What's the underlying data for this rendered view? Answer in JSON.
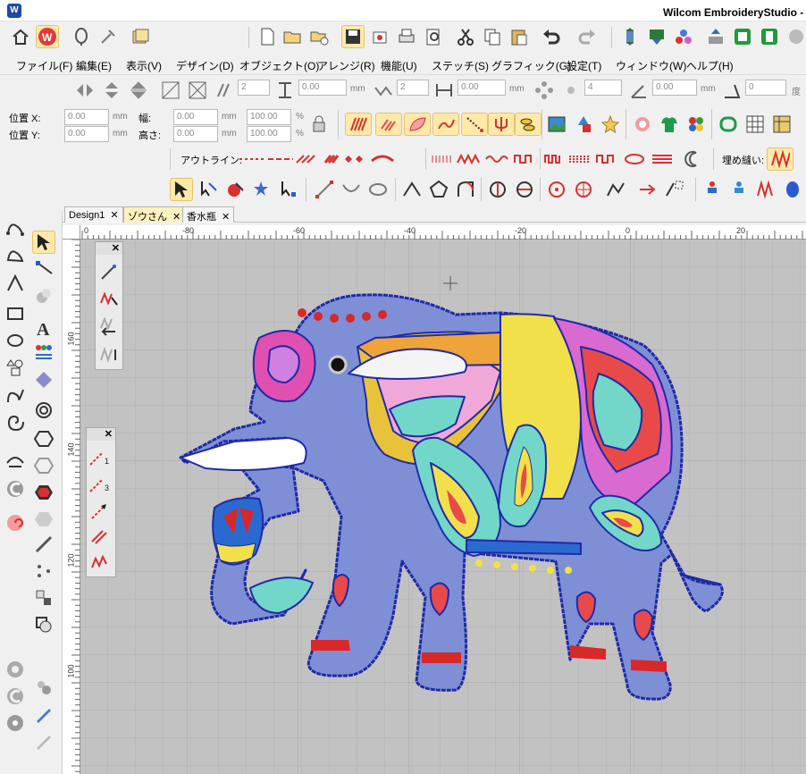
{
  "window": {
    "title": "Wilcom EmbroideryStudio - ゾ",
    "app_icon": "wilcom-logo-icon"
  },
  "menu": [
    "ファイル(F)",
    "編集(E)",
    "表示(V)",
    "デザイン(D)",
    "オブジェクト(O)",
    "アレンジ(R)",
    "機能(U)",
    "ステッチ(S)",
    "グラフィック(G)",
    "設定(T)",
    "ウィンドウ(W)",
    "ヘルプ(H)"
  ],
  "transform_toolbar": {
    "rows_value": "2",
    "spacing_value": "0.00",
    "columns_value": "2",
    "offset_value": "0.00",
    "count_value": "4",
    "angle_value": "0.00",
    "slant_value": "0",
    "unit_mm": "mm",
    "unit_deg": "度"
  },
  "property_bar": {
    "pos_x_label": "位置 X:",
    "pos_y_label": "位置 Y:",
    "pos_x": "0.00",
    "pos_y": "0.00",
    "width_label": "幅:",
    "height_label": "高さ:",
    "width": "0.00",
    "height": "0.00",
    "scale_w": "100.00",
    "scale_h": "100.00",
    "unit_mm": "mm",
    "unit_pct": "%"
  },
  "stitch_bar": {
    "outline_label": "アウトライン:",
    "fill_label": "埋め縫い:"
  },
  "tabs": [
    {
      "label": "Design1",
      "active": false
    },
    {
      "label": "ゾウさん",
      "active": true
    },
    {
      "label": "香水瓶",
      "active": false
    }
  ],
  "ruler": {
    "top_labels": [
      "0",
      "-80",
      "-60",
      "-40",
      "-20",
      "0",
      "20"
    ],
    "left_labels": [
      "160",
      "140",
      "120",
      "100"
    ]
  },
  "float_panel_a": {
    "close": "✕"
  },
  "float_panel_b": {
    "close": "✕",
    "steps": [
      "1",
      "3"
    ]
  },
  "colors": {
    "accent_tab": "#fff0bf",
    "canvas": "#c2c2c2",
    "grid": "#b2b2b2",
    "stitch_blue": "#2233a8"
  }
}
